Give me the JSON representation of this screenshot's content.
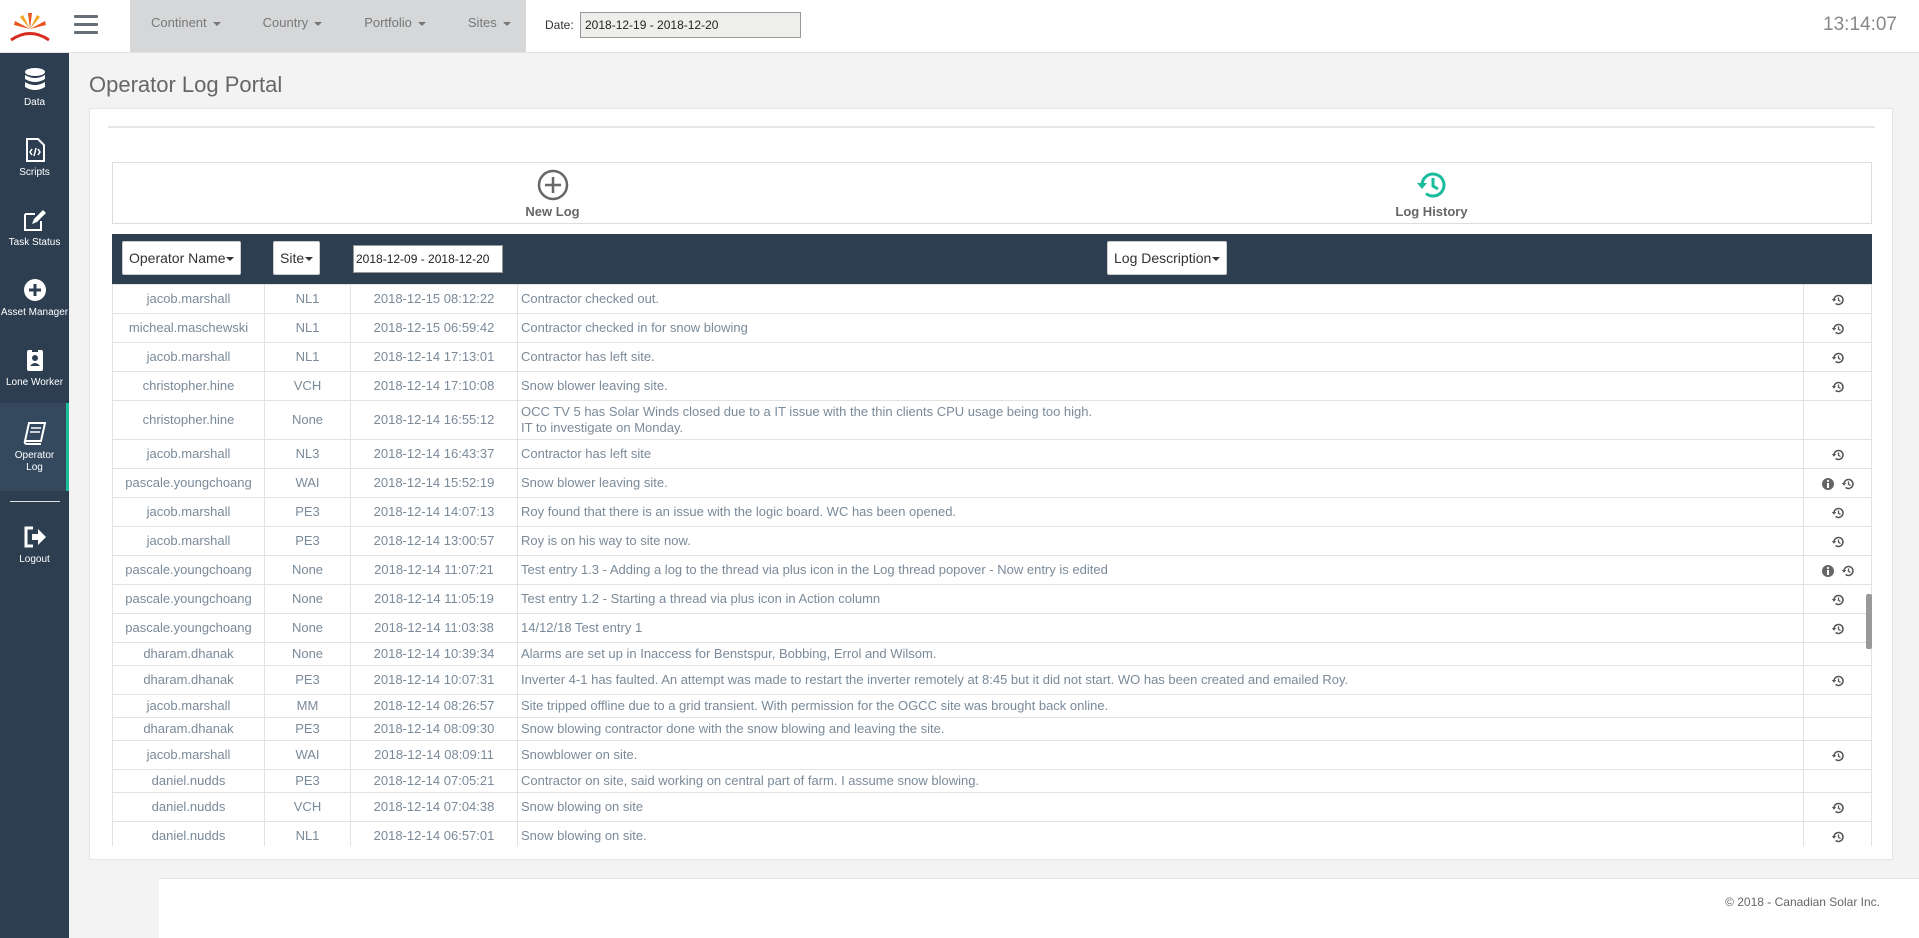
{
  "header": {
    "filters": [
      "Continent",
      "Country",
      "Portfolio",
      "Sites"
    ],
    "date_label": "Date:",
    "date_value": "2018-12-19 - 2018-12-20",
    "clock": "13:14:07"
  },
  "sidebar": {
    "items": [
      {
        "label": "Data",
        "icon": "database-icon"
      },
      {
        "label": "Scripts",
        "icon": "script-file-icon"
      },
      {
        "label": "Task Status",
        "icon": "edit-icon"
      },
      {
        "label": "Asset Manager",
        "icon": "plus-circle-icon"
      },
      {
        "label": "Lone Worker",
        "icon": "badge-icon"
      },
      {
        "label": "Operator Log",
        "icon": "book-icon"
      },
      {
        "label": "Logout",
        "icon": "logout-icon"
      }
    ]
  },
  "main": {
    "title": "Operator Log Portal",
    "new_log": "New Log",
    "log_history": "Log History"
  },
  "table": {
    "header": {
      "operator": "Operator Name",
      "site": "Site",
      "date_range": "2018-12-09 - 2018-12-20",
      "description": "Log Description"
    },
    "rows": [
      {
        "op": "jacob.marshall",
        "site": "NL1",
        "dt": "2018-12-15 08:12:22",
        "desc": "Contractor checked out.",
        "info": false,
        "hist": true
      },
      {
        "op": "micheal.maschewski",
        "site": "NL1",
        "dt": "2018-12-15 06:59:42",
        "desc": "Contractor checked in for snow blowing",
        "info": false,
        "hist": true
      },
      {
        "op": "jacob.marshall",
        "site": "NL1",
        "dt": "2018-12-14 17:13:01",
        "desc": "Contractor has left site.",
        "info": false,
        "hist": true
      },
      {
        "op": "christopher.hine",
        "site": "VCH",
        "dt": "2018-12-14 17:10:08",
        "desc": "Snow blower leaving site.",
        "info": false,
        "hist": true
      },
      {
        "op": "christopher.hine",
        "site": "None",
        "dt": "2018-12-14 16:55:12",
        "desc": "OCC TV 5 has Solar Winds closed due to a IT issue with the thin clients CPU usage being too high.",
        "desc2": "IT to investigate on Monday.",
        "info": false,
        "hist": false
      },
      {
        "op": "jacob.marshall",
        "site": "NL3",
        "dt": "2018-12-14 16:43:37",
        "desc": "Contractor has left site",
        "info": false,
        "hist": true
      },
      {
        "op": "pascale.youngchoang",
        "site": "WAI",
        "dt": "2018-12-14 15:52:19",
        "desc": "Snow blower leaving site.",
        "info": true,
        "hist": true
      },
      {
        "op": "jacob.marshall",
        "site": "PE3",
        "dt": "2018-12-14 14:07:13",
        "desc": "Roy found that there is an issue with the logic board. WC has been opened.",
        "info": false,
        "hist": true
      },
      {
        "op": "jacob.marshall",
        "site": "PE3",
        "dt": "2018-12-14 13:00:57",
        "desc": "Roy is on his way to site now.",
        "info": false,
        "hist": true
      },
      {
        "op": "pascale.youngchoang",
        "site": "None",
        "dt": "2018-12-14 11:07:21",
        "desc": "Test entry 1.3 - Adding a log to the thread via plus icon in the Log thread popover - Now entry is edited",
        "info": true,
        "hist": true
      },
      {
        "op": "pascale.youngchoang",
        "site": "None",
        "dt": "2018-12-14 11:05:19",
        "desc": "Test entry 1.2 - Starting a thread via plus icon in Action column",
        "info": false,
        "hist": true
      },
      {
        "op": "pascale.youngchoang",
        "site": "None",
        "dt": "2018-12-14 11:03:38",
        "desc": "14/12/18 Test entry 1",
        "info": false,
        "hist": true
      },
      {
        "op": "dharam.dhanak",
        "site": "None",
        "dt": "2018-12-14 10:39:34",
        "desc": "Alarms are set up in Inaccess for Benstspur, Bobbing, Errol and Wilsom.",
        "info": false,
        "hist": false,
        "compact": true
      },
      {
        "op": "dharam.dhanak",
        "site": "PE3",
        "dt": "2018-12-14 10:07:31",
        "desc": "Inverter 4-1 has faulted. An attempt was made to restart the inverter remotely at 8:45 but it did not start. WO has been created and emailed Roy.",
        "info": false,
        "hist": true
      },
      {
        "op": "jacob.marshall",
        "site": "MM",
        "dt": "2018-12-14 08:26:57",
        "desc": "Site tripped offline due to a grid transient. With permission for the OGCC site was brought back online.",
        "info": false,
        "hist": false,
        "compact": true
      },
      {
        "op": "dharam.dhanak",
        "site": "PE3",
        "dt": "2018-12-14 08:09:30",
        "desc": "Snow blowing contractor done with the snow blowing and leaving the site.",
        "info": false,
        "hist": false,
        "compact": true
      },
      {
        "op": "jacob.marshall",
        "site": "WAI",
        "dt": "2018-12-14 08:09:11",
        "desc": "Snowblower on site.",
        "info": false,
        "hist": true
      },
      {
        "op": "daniel.nudds",
        "site": "PE3",
        "dt": "2018-12-14 07:05:21",
        "desc": "Contractor on site, said working on central part of farm. I assume snow blowing.",
        "info": false,
        "hist": false,
        "compact": true
      },
      {
        "op": "daniel.nudds",
        "site": "VCH",
        "dt": "2018-12-14 07:04:38",
        "desc": "Snow blowing on site",
        "info": false,
        "hist": true
      },
      {
        "op": "daniel.nudds",
        "site": "NL1",
        "dt": "2018-12-14 06:57:01",
        "desc": "Snow blowing on site.",
        "info": false,
        "hist": true
      }
    ]
  },
  "footer": "© 2018 - Canadian Solar Inc."
}
